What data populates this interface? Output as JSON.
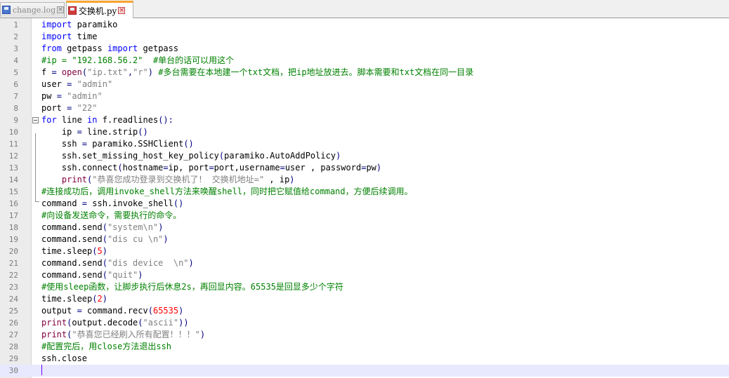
{
  "tabs": [
    {
      "label": "change.log",
      "active": false,
      "icon": "file-icon"
    },
    {
      "label": "交换机.py",
      "active": true,
      "icon": "file-modified-icon"
    }
  ],
  "colors": {
    "keyword": "#0000ff",
    "string": "#808080",
    "number": "#ff0000",
    "comment": "#008000",
    "current_line": "#e8e8ff",
    "active_tab_accent": "#f7a530"
  },
  "editor": {
    "current_line": 30,
    "lines": [
      {
        "n": "1",
        "tokens": [
          {
            "t": "import",
            "c": "kw"
          },
          {
            "t": " paramiko",
            "c": "plain"
          }
        ]
      },
      {
        "n": "2",
        "tokens": [
          {
            "t": "import",
            "c": "kw"
          },
          {
            "t": " time",
            "c": "plain"
          }
        ]
      },
      {
        "n": "3",
        "tokens": [
          {
            "t": "from",
            "c": "kw"
          },
          {
            "t": " getpass ",
            "c": "plain"
          },
          {
            "t": "import",
            "c": "kw"
          },
          {
            "t": " getpass",
            "c": "plain"
          }
        ]
      },
      {
        "n": "4",
        "tokens": [
          {
            "t": "#ip = \"192.168.56.2\"  #单台的话可以用这个",
            "c": "cmt"
          }
        ]
      },
      {
        "n": "5",
        "tokens": [
          {
            "t": "f ",
            "c": "plain"
          },
          {
            "t": "=",
            "c": "op"
          },
          {
            "t": " ",
            "c": "plain"
          },
          {
            "t": "open",
            "c": "fn"
          },
          {
            "t": "(",
            "c": "op"
          },
          {
            "t": "\"ip.txt\"",
            "c": "str"
          },
          {
            "t": ",",
            "c": "op"
          },
          {
            "t": "\"r\"",
            "c": "str"
          },
          {
            "t": ")",
            "c": "op"
          },
          {
            "t": " #多台需要在本地建一个txt文档，把ip地址放进去。脚本需要和txt文档在同一目录",
            "c": "cmt"
          }
        ]
      },
      {
        "n": "6",
        "tokens": [
          {
            "t": "user ",
            "c": "plain"
          },
          {
            "t": "=",
            "c": "op"
          },
          {
            "t": " ",
            "c": "plain"
          },
          {
            "t": "\"admin\"",
            "c": "str"
          }
        ]
      },
      {
        "n": "7",
        "tokens": [
          {
            "t": "pw ",
            "c": "plain"
          },
          {
            "t": "=",
            "c": "op"
          },
          {
            "t": " ",
            "c": "plain"
          },
          {
            "t": "\"admin\"",
            "c": "str"
          }
        ]
      },
      {
        "n": "8",
        "tokens": [
          {
            "t": "port ",
            "c": "plain"
          },
          {
            "t": "=",
            "c": "op"
          },
          {
            "t": " ",
            "c": "plain"
          },
          {
            "t": "\"22\"",
            "c": "str"
          }
        ]
      },
      {
        "n": "9",
        "tokens": [
          {
            "t": "for",
            "c": "kw"
          },
          {
            "t": " line ",
            "c": "plain"
          },
          {
            "t": "in",
            "c": "kw"
          },
          {
            "t": " f.readlines",
            "c": "plain"
          },
          {
            "t": "():",
            "c": "op"
          }
        ]
      },
      {
        "n": "10",
        "tokens": [
          {
            "t": "    ip ",
            "c": "plain"
          },
          {
            "t": "=",
            "c": "op"
          },
          {
            "t": " line.strip",
            "c": "plain"
          },
          {
            "t": "()",
            "c": "op"
          }
        ]
      },
      {
        "n": "11",
        "tokens": [
          {
            "t": "    ssh ",
            "c": "plain"
          },
          {
            "t": "=",
            "c": "op"
          },
          {
            "t": " paramiko.SSHClient",
            "c": "plain"
          },
          {
            "t": "()",
            "c": "op"
          }
        ]
      },
      {
        "n": "12",
        "tokens": [
          {
            "t": "    ssh.set_missing_host_key_policy",
            "c": "plain"
          },
          {
            "t": "(",
            "c": "op"
          },
          {
            "t": "paramiko.AutoAddPolicy",
            "c": "plain"
          },
          {
            "t": ")",
            "c": "op"
          }
        ]
      },
      {
        "n": "13",
        "tokens": [
          {
            "t": "    ssh.connect",
            "c": "plain"
          },
          {
            "t": "(",
            "c": "op"
          },
          {
            "t": "hostname",
            "c": "plain"
          },
          {
            "t": "=",
            "c": "op"
          },
          {
            "t": "ip, port",
            "c": "plain"
          },
          {
            "t": "=",
            "c": "op"
          },
          {
            "t": "port,username",
            "c": "plain"
          },
          {
            "t": "=",
            "c": "op"
          },
          {
            "t": "user , password",
            "c": "plain"
          },
          {
            "t": "=",
            "c": "op"
          },
          {
            "t": "pw",
            "c": "plain"
          },
          {
            "t": ")",
            "c": "op"
          }
        ]
      },
      {
        "n": "14",
        "tokens": [
          {
            "t": "    ",
            "c": "plain"
          },
          {
            "t": "print",
            "c": "fn"
          },
          {
            "t": "(",
            "c": "op"
          },
          {
            "t": "\"恭喜您成功登录到交换机了！ 交换机地址=\"",
            "c": "str"
          },
          {
            "t": " , ip",
            "c": "plain"
          },
          {
            "t": ")",
            "c": "op"
          }
        ]
      },
      {
        "n": "15",
        "tokens": [
          {
            "t": "#连接成功后，调用invoke_shell方法来唤醒shell，同时把它赋值给command，方便后续调用。",
            "c": "cmt"
          }
        ]
      },
      {
        "n": "16",
        "tokens": [
          {
            "t": "command ",
            "c": "plain"
          },
          {
            "t": "=",
            "c": "op"
          },
          {
            "t": " ssh.invoke_shell",
            "c": "plain"
          },
          {
            "t": "()",
            "c": "op"
          }
        ]
      },
      {
        "n": "17",
        "tokens": [
          {
            "t": "#向设备发送命令，需要执行的命令。",
            "c": "cmt"
          }
        ]
      },
      {
        "n": "18",
        "tokens": [
          {
            "t": "command.send",
            "c": "plain"
          },
          {
            "t": "(",
            "c": "op"
          },
          {
            "t": "\"system\\n\"",
            "c": "str"
          },
          {
            "t": ")",
            "c": "op"
          }
        ]
      },
      {
        "n": "19",
        "tokens": [
          {
            "t": "command.send",
            "c": "plain"
          },
          {
            "t": "(",
            "c": "op"
          },
          {
            "t": "\"dis cu \\n\"",
            "c": "str"
          },
          {
            "t": ")",
            "c": "op"
          }
        ]
      },
      {
        "n": "20",
        "tokens": [
          {
            "t": "time.sleep",
            "c": "plain"
          },
          {
            "t": "(",
            "c": "op"
          },
          {
            "t": "5",
            "c": "num"
          },
          {
            "t": ")",
            "c": "op"
          }
        ]
      },
      {
        "n": "21",
        "tokens": [
          {
            "t": "command.send",
            "c": "plain"
          },
          {
            "t": "(",
            "c": "op"
          },
          {
            "t": "\"dis device  \\n\"",
            "c": "str"
          },
          {
            "t": ")",
            "c": "op"
          }
        ]
      },
      {
        "n": "22",
        "tokens": [
          {
            "t": "command.send",
            "c": "plain"
          },
          {
            "t": "(",
            "c": "op"
          },
          {
            "t": "\"quit\"",
            "c": "str"
          },
          {
            "t": ")",
            "c": "op"
          }
        ]
      },
      {
        "n": "23",
        "tokens": [
          {
            "t": "#使用sleep函数，让脚步执行后休息2s，再回显内容。65535是回显多少个字符",
            "c": "cmt"
          }
        ]
      },
      {
        "n": "24",
        "tokens": [
          {
            "t": "time.sleep",
            "c": "plain"
          },
          {
            "t": "(",
            "c": "op"
          },
          {
            "t": "2",
            "c": "num"
          },
          {
            "t": ")",
            "c": "op"
          }
        ]
      },
      {
        "n": "25",
        "tokens": [
          {
            "t": "output ",
            "c": "plain"
          },
          {
            "t": "=",
            "c": "op"
          },
          {
            "t": " command.recv",
            "c": "plain"
          },
          {
            "t": "(",
            "c": "op"
          },
          {
            "t": "65535",
            "c": "num"
          },
          {
            "t": ")",
            "c": "op"
          }
        ]
      },
      {
        "n": "26",
        "tokens": [
          {
            "t": "print",
            "c": "fn"
          },
          {
            "t": "(",
            "c": "op"
          },
          {
            "t": "output.decode",
            "c": "plain"
          },
          {
            "t": "(",
            "c": "op"
          },
          {
            "t": "\"ascii\"",
            "c": "str"
          },
          {
            "t": "))",
            "c": "op"
          }
        ]
      },
      {
        "n": "27",
        "tokens": [
          {
            "t": "print",
            "c": "fn"
          },
          {
            "t": "(",
            "c": "op"
          },
          {
            "t": "\"恭喜您已经刷入所有配置！！！\"",
            "c": "str"
          },
          {
            "t": ")",
            "c": "op"
          }
        ]
      },
      {
        "n": "28",
        "tokens": [
          {
            "t": "#配置完后，用close方法退出ssh",
            "c": "cmt"
          }
        ]
      },
      {
        "n": "29",
        "tokens": [
          {
            "t": "ssh.close",
            "c": "plain"
          }
        ]
      },
      {
        "n": "30",
        "tokens": []
      }
    ]
  }
}
